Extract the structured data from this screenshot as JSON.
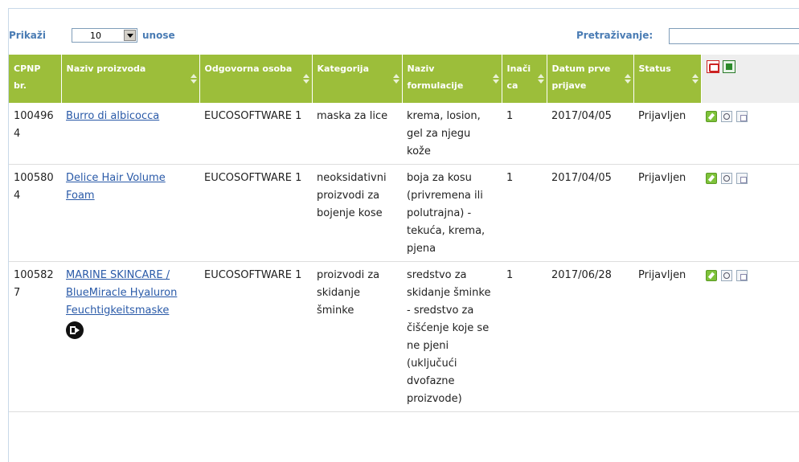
{
  "controls": {
    "show_label": "Prikaži",
    "show_value": "10",
    "entries_label": "unose",
    "search_label": "Pretraživanje:",
    "search_value": ""
  },
  "table": {
    "headers": [
      {
        "line1": "CPNP br.",
        "line2": ""
      },
      {
        "line1": "Naziv proizvoda",
        "line2": ""
      },
      {
        "line1": "Odgovorna osoba",
        "line2": ""
      },
      {
        "line1": "Kategorija",
        "line2": ""
      },
      {
        "line1": "Naziv",
        "line2": "formulacije"
      },
      {
        "line1": "Inači",
        "line2": "ca"
      },
      {
        "line1": "Datum prve",
        "line2": "prijave"
      },
      {
        "line1": "Status",
        "line2": ""
      }
    ],
    "rows": [
      {
        "cpnp": "1004964",
        "name": "Burro di albicocca",
        "person": "EUCOSOFTWARE 1",
        "category": "maska za lice",
        "formulation": "krema, losion, gel za njegu kože",
        "version": "1",
        "date": "2017/04/05",
        "status": "Prijavljen"
      },
      {
        "cpnp": "1005804",
        "name": "Delice Hair Volume Foam",
        "person": "EUCOSOFTWARE 1",
        "category": "neoksidativni proizvodi za bojenje kose",
        "formulation": "boja za kosu (privremena ili polutrajna) - tekuća, krema, pjena",
        "version": "1",
        "date": "2017/04/05",
        "status": "Prijavljen"
      },
      {
        "cpnp": "1005827",
        "name": "MARINE SKINCARE / BlueMiracle Hyaluron Feuchtigkeitsmaske",
        "person": "EUCOSOFTWARE 1",
        "category": "proizvodi za skidanje šminke",
        "formulation": "sredstvo za skidanje šminke - sredstvo za čišćenje koje se ne pjeni (uključući dvofazne proizvode)",
        "version": "1",
        "date": "2017/06/28",
        "status": "Prijavljen"
      }
    ]
  },
  "icons": {
    "export": [
      "pdf-export-icon",
      "excel-export-icon"
    ],
    "row_actions": [
      "edit-icon",
      "view-icon",
      "copy-icon"
    ],
    "notification": "notification-exit-icon"
  },
  "colors": {
    "header_bg": "#9cbe3a",
    "link": "#2a5aa8",
    "control_label": "#4a7cb4"
  }
}
